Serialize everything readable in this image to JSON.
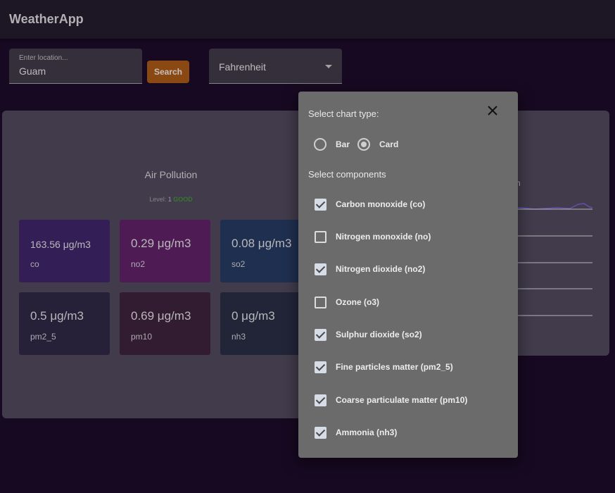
{
  "app": {
    "title": "WeatherApp"
  },
  "search": {
    "label": "Enter location...",
    "value": "Guam",
    "button": "Search"
  },
  "units": {
    "selected": "Fahrenheit"
  },
  "air_pollution": {
    "title": "Air Pollution",
    "level_prefix": "Level: ",
    "level_num": "1",
    "level_text": "GOOD",
    "cards": [
      {
        "value": "163.56 μg/m3",
        "name": "co",
        "color": "#3b2561"
      },
      {
        "value": "0.29 μg/m3",
        "name": "no2",
        "color": "#5c2060"
      },
      {
        "value": "0.08 μg/m3",
        "name": "so2",
        "color": "#24385a"
      },
      {
        "value": "0.5 μg/m3",
        "name": "pm2_5",
        "color": "#2d2640"
      },
      {
        "value": "0.69 μg/m3",
        "name": "pm10",
        "color": "#3a2137"
      },
      {
        "value": "0 μg/m3",
        "name": "nh3",
        "color": "#272c3f"
      }
    ]
  },
  "right_panel": {
    "fragment": "h"
  },
  "dialog": {
    "title": "Select chart type:",
    "chart_types": [
      {
        "label": "Bar",
        "selected": false
      },
      {
        "label": "Card",
        "selected": true
      }
    ],
    "components_title": "Select components",
    "components": [
      {
        "label": "Carbon monoxide (co)",
        "checked": true
      },
      {
        "label": "Nitrogen monoxide (no)",
        "checked": false
      },
      {
        "label": "Nitrogen dioxide (no2)",
        "checked": true
      },
      {
        "label": "Ozone (o3)",
        "checked": false
      },
      {
        "label": "Sulphur dioxide (so2)",
        "checked": true
      },
      {
        "label": "Fine particles matter (pm2_5)",
        "checked": true
      },
      {
        "label": "Coarse particulate matter (pm10)",
        "checked": true
      },
      {
        "label": "Ammonia (nh3)",
        "checked": true
      }
    ]
  }
}
